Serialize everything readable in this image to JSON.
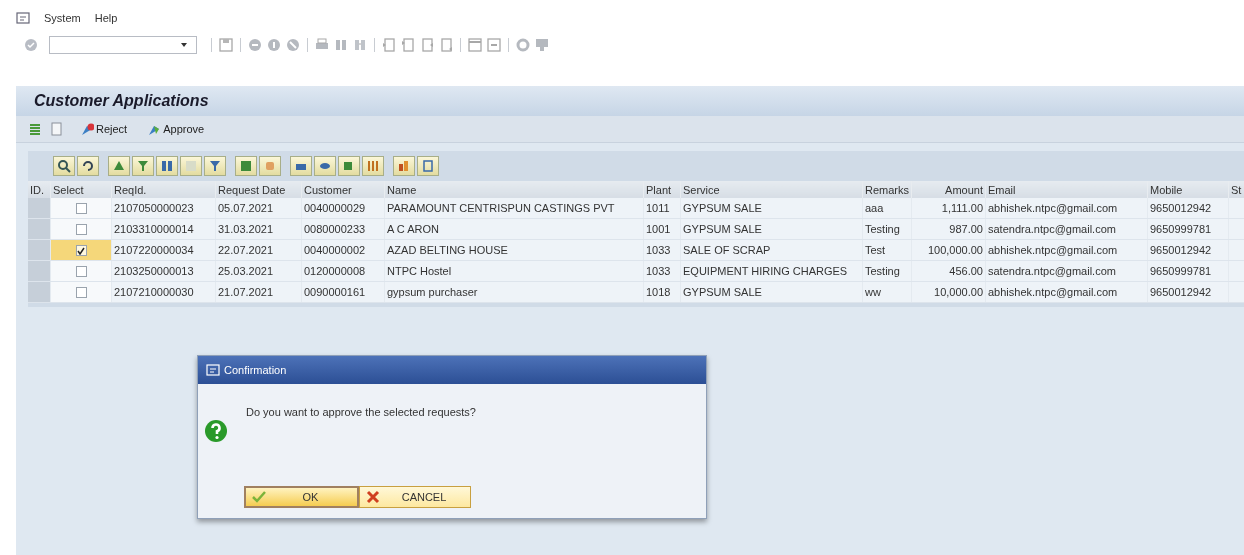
{
  "menu": [
    {
      "label": "System"
    },
    {
      "label": "Help"
    }
  ],
  "title": "Customer Applications",
  "actions": [
    {
      "label": "Reject",
      "kind": "reject"
    },
    {
      "label": "Approve",
      "kind": "approve"
    }
  ],
  "table": {
    "columns": [
      "ID.",
      "Select",
      "ReqId.",
      "Request Date",
      "Customer",
      "Name",
      "Plant",
      "Service",
      "Remarks",
      "Amount",
      "Email",
      "Mobile",
      "St"
    ],
    "rows": [
      {
        "selected": false,
        "checked": false,
        "cells": [
          "",
          "",
          "2107050000023",
          "05.07.2021",
          "0040000029",
          "PARAMOUNT CENTRISPUN CASTINGS PVT",
          "1011",
          "GYPSUM SALE",
          "aaa",
          "1,111.00",
          "abhishek.ntpc@gmail.com",
          "9650012942"
        ]
      },
      {
        "selected": false,
        "checked": false,
        "cells": [
          "",
          "",
          "2103310000014",
          "31.03.2021",
          "0080000233",
          "A C ARON",
          "1001",
          "GYPSUM SALE",
          "Testing",
          "987.00",
          "satendra.ntpc@gmail.com",
          "9650999781"
        ]
      },
      {
        "selected": true,
        "checked": true,
        "cells": [
          "",
          "",
          "2107220000034",
          "22.07.2021",
          "0040000002",
          "AZAD BELTING HOUSE",
          "1033",
          "SALE OF SCRAP",
          "Test",
          "100,000.00",
          "abhishek.ntpc@gmail.com",
          "9650012942"
        ]
      },
      {
        "selected": false,
        "checked": false,
        "cells": [
          "",
          "",
          "2103250000013",
          "25.03.2021",
          "0120000008",
          "NTPC Hostel",
          "1033",
          "EQUIPMENT HIRING CHARGES",
          "Testing",
          "456.00",
          "satendra.ntpc@gmail.com",
          "9650999781"
        ]
      },
      {
        "selected": false,
        "checked": false,
        "cells": [
          "",
          "",
          "2107210000030",
          "21.07.2021",
          "0090000161",
          "gypsum purchaser",
          "1018",
          "GYPSUM SALE",
          "ww",
          "10,000.00",
          "abhishek.ntpc@gmail.com",
          "9650012942"
        ]
      }
    ]
  },
  "dialog": {
    "title": "Confirmation",
    "message": "Do you want to approve the selected requests?",
    "buttons": [
      {
        "label": "OK",
        "kind": "ok"
      },
      {
        "label": "CANCEL",
        "kind": "cancel"
      }
    ]
  }
}
